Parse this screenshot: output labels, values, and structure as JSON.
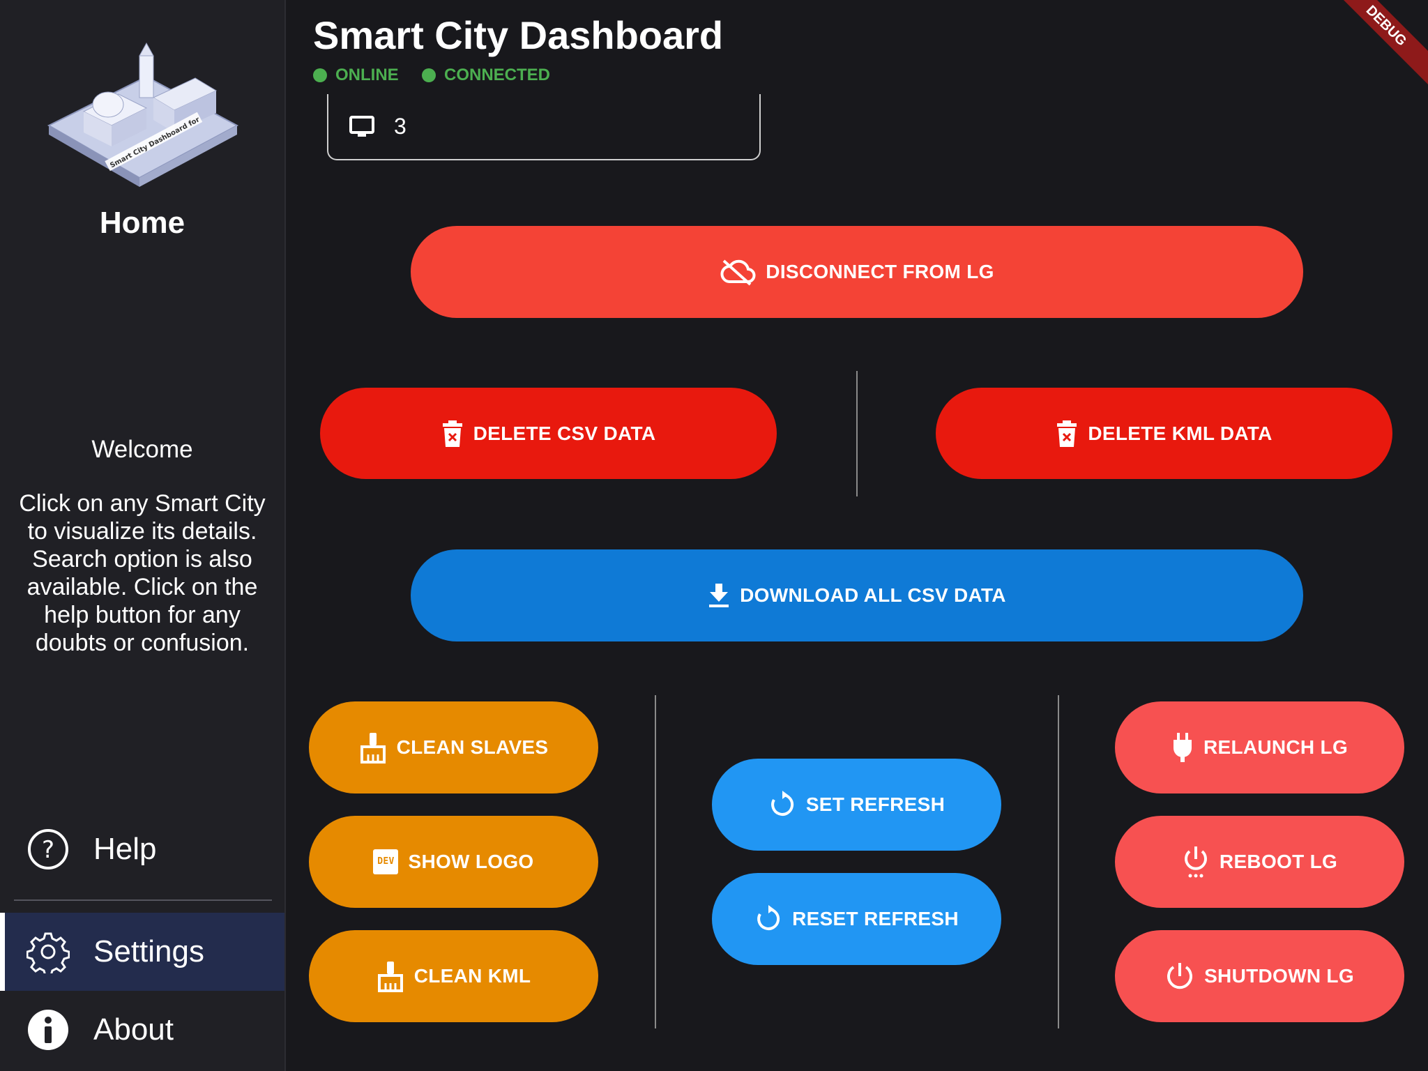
{
  "app": {
    "title": "Smart City Dashboard"
  },
  "status": {
    "online_label": "ONLINE",
    "connected_label": "CONNECTED",
    "color": "#4caf50"
  },
  "sidebar": {
    "home_title": "Home",
    "welcome_title": "Welcome",
    "welcome_text": "Click on any Smart City to visualize its details. Search option is also available. Click on the help button for any doubts or confusion.",
    "nav": [
      {
        "label": "Help",
        "icon": "help-circle-icon"
      },
      {
        "label": "Settings",
        "icon": "gear-icon",
        "selected": true
      },
      {
        "label": "About",
        "icon": "info-icon"
      }
    ]
  },
  "lg_screens": {
    "value": "3",
    "icon": "monitor-icon"
  },
  "buttons": {
    "disconnect": "DISCONNECT FROM LG",
    "delete_csv": "DELETE CSV DATA",
    "delete_kml": "DELETE KML DATA",
    "download_csv": "DOWNLOAD ALL CSV DATA",
    "clean_slaves": "CLEAN SLAVES",
    "show_logo": "SHOW LOGO",
    "clean_kml": "CLEAN KML",
    "set_refresh": "SET REFRESH",
    "reset_refresh": "RESET REFRESH",
    "relaunch": "RELAUNCH LG",
    "reboot": "REBOOT LG",
    "shutdown": "SHUTDOWN LG",
    "show_logo_badge": "DEV"
  },
  "debug_banner": "DEBUG",
  "colors": {
    "background": "#18181c",
    "sidebar": "#202025",
    "selected_nav": "#232c4d",
    "red_primary": "#f44336",
    "red_delete": "#e8190e",
    "blue_download": "#0f7ad6",
    "orange": "#e68a00",
    "blue_light": "#2196f3",
    "red_light": "#f75151"
  }
}
